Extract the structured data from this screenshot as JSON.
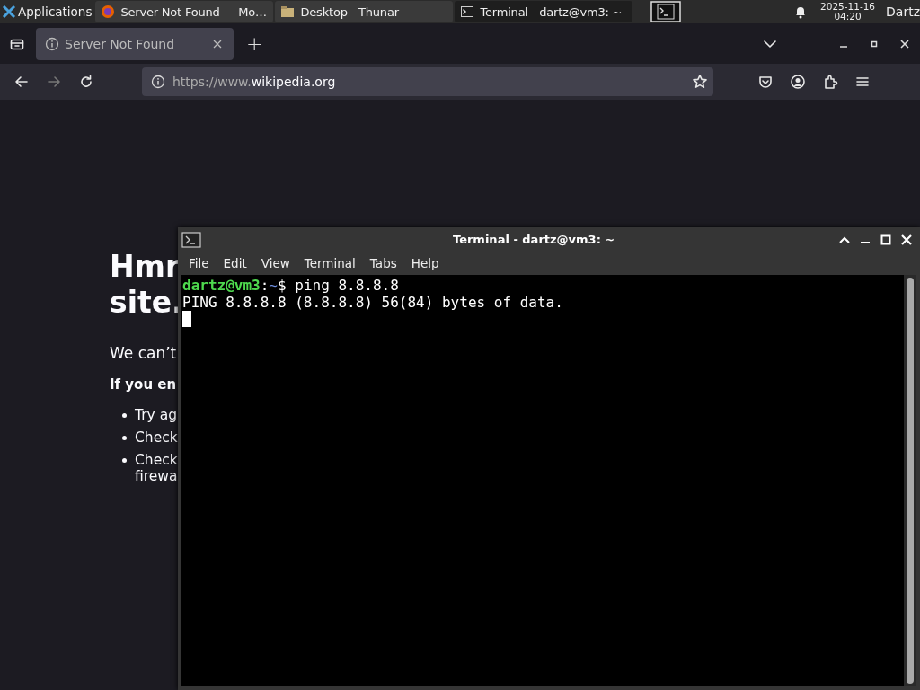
{
  "taskbar": {
    "apps_menu": "Applications",
    "windows": [
      {
        "title": "Server Not Found — Mo…",
        "kind": "firefox",
        "selected": false
      },
      {
        "title": "Desktop - Thunar",
        "kind": "thunar",
        "selected": false
      },
      {
        "title": "Terminal - dartz@vm3: ~",
        "kind": "terminal",
        "selected": true
      }
    ],
    "clock": {
      "date": "2025-11-16",
      "time": "04:20"
    },
    "user": "Dartz"
  },
  "browser": {
    "tabs": [
      {
        "title": "Server Not Found",
        "selected": true
      }
    ],
    "new_tab": "+",
    "url": {
      "prefix": "https://www.",
      "host": "wikipedia.org"
    },
    "forward_disabled": true,
    "page": {
      "heading": "Hmr\nsite.",
      "message": "We can’t",
      "bold_line": "If you en",
      "bullets": [
        "Try ag",
        "Check",
        "Check\nfirewa"
      ]
    }
  },
  "terminal": {
    "title": "Terminal - dartz@vm3: ~",
    "menu": [
      "File",
      "Edit",
      "View",
      "Terminal",
      "Tabs",
      "Help"
    ],
    "lines": [
      {
        "kind": "prompt",
        "user": "dartz@vm3",
        "sep": ":",
        "path": "~",
        "command": "$ ping 8.8.8.8"
      },
      {
        "kind": "output",
        "text": "PING 8.8.8.8 (8.8.8.8) 56(84) bytes of data."
      }
    ],
    "cursor": true
  }
}
